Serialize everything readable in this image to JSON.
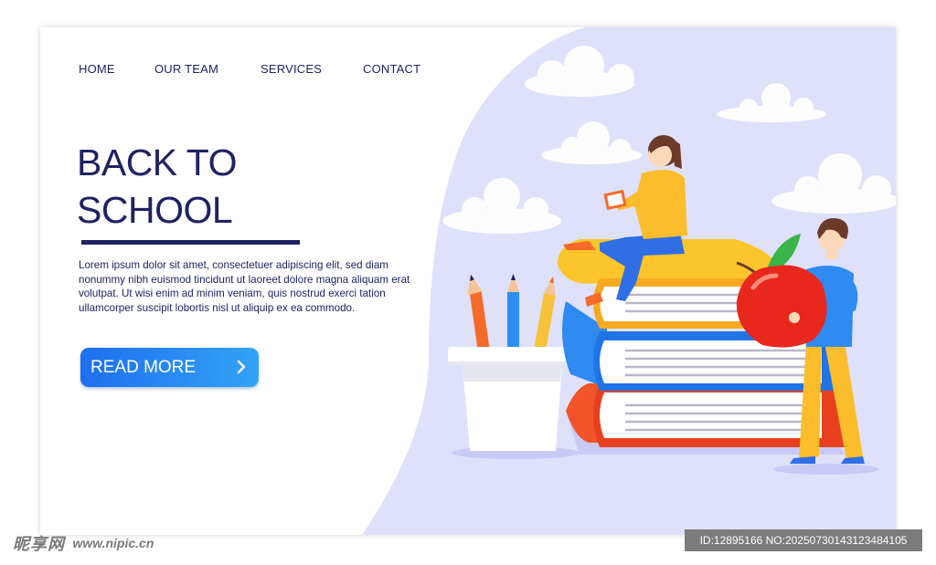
{
  "nav": {
    "home": "HOME",
    "our_team": "OUR TEAM",
    "services": "SERVICES",
    "contact": "CONTACT"
  },
  "hero": {
    "title_line1": "BACK TO",
    "title_line2": "SCHOOL",
    "description": "Lorem ipsum dolor sit amet, consectetuer adipiscing elit, sed diam nonummy nibh euismod tincidunt ut laoreet dolore magna aliquam erat volutpat. Ut wisi enim ad minim veniam, quis nostrud exerci tation ullamcorper suscipit lobortis nisl ut aliquip ex ea commodo.",
    "read_more": "READ MORE"
  },
  "watermark": {
    "logo_text": "昵享网",
    "url": "www.nipic.cn",
    "id_text": "ID:12895166 NO:20250730143123484105"
  },
  "colors": {
    "navy": "#1f2261",
    "background_blob": "#dfe1fb",
    "button_start": "#1e6ff0",
    "button_end": "#33a3f5"
  }
}
